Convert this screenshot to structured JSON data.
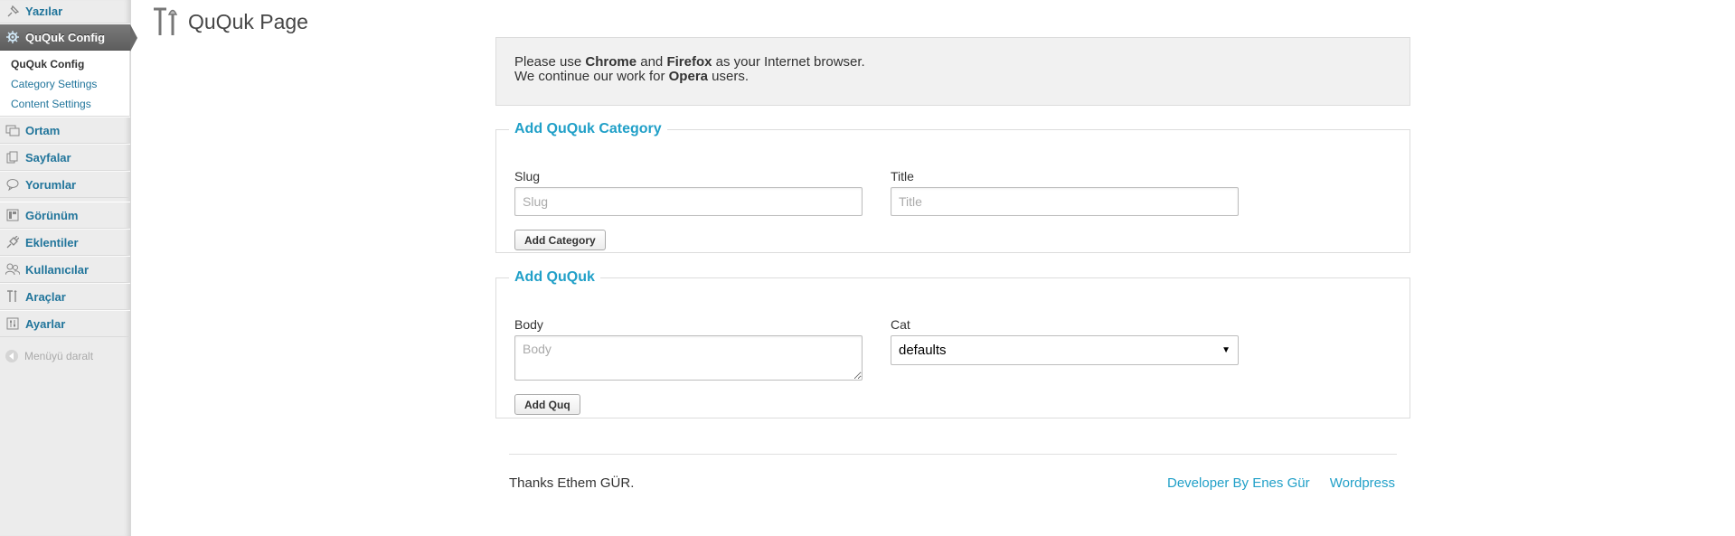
{
  "sidebar": {
    "items": [
      {
        "label": "Yazılar",
        "icon": "pin-icon"
      },
      {
        "label": "QuQuk Config",
        "icon": "gear-icon"
      },
      {
        "label": "Ortam",
        "icon": "media-icon"
      },
      {
        "label": "Sayfalar",
        "icon": "pages-icon"
      },
      {
        "label": "Yorumlar",
        "icon": "comment-icon"
      },
      {
        "label": "Görünüm",
        "icon": "appearance-icon"
      },
      {
        "label": "Eklentiler",
        "icon": "plugin-icon"
      },
      {
        "label": "Kullanıcılar",
        "icon": "users-icon"
      },
      {
        "label": "Araçlar",
        "icon": "tools-icon"
      },
      {
        "label": "Ayarlar",
        "icon": "settings-icon"
      }
    ],
    "submenu": [
      "QuQuk Config",
      "Category Settings",
      "Content Settings"
    ],
    "collapse_label": "Menüyü daralt"
  },
  "header": {
    "title": "QuQuk Page",
    "icon": "tools-icon"
  },
  "notice": {
    "line1_pre": "Please use ",
    "browser1": "Chrome",
    "and": " and ",
    "browser2": "Firefox",
    "line1_post": " as your Internet browser.",
    "line2_pre": "We continue our work for ",
    "browser3": "Opera",
    "line2_post": " users."
  },
  "category_form": {
    "legend": "Add QuQuk Category",
    "slug_label": "Slug",
    "slug_placeholder": "Slug",
    "title_label": "Title",
    "title_placeholder": "Title",
    "submit_label": "Add Category"
  },
  "ququk_form": {
    "legend": "Add QuQuk",
    "body_label": "Body",
    "body_placeholder": "Body",
    "cat_label": "Cat",
    "cat_selected": "defaults",
    "submit_label": "Add Quq"
  },
  "footer": {
    "credit": "Thanks Ethem GÜR.",
    "links": [
      "Developer By Enes Gür",
      "Wordpress"
    ]
  },
  "colors": {
    "link": "#21759b",
    "accent": "#21a0c8",
    "active_menu": "#6a6a6a"
  }
}
